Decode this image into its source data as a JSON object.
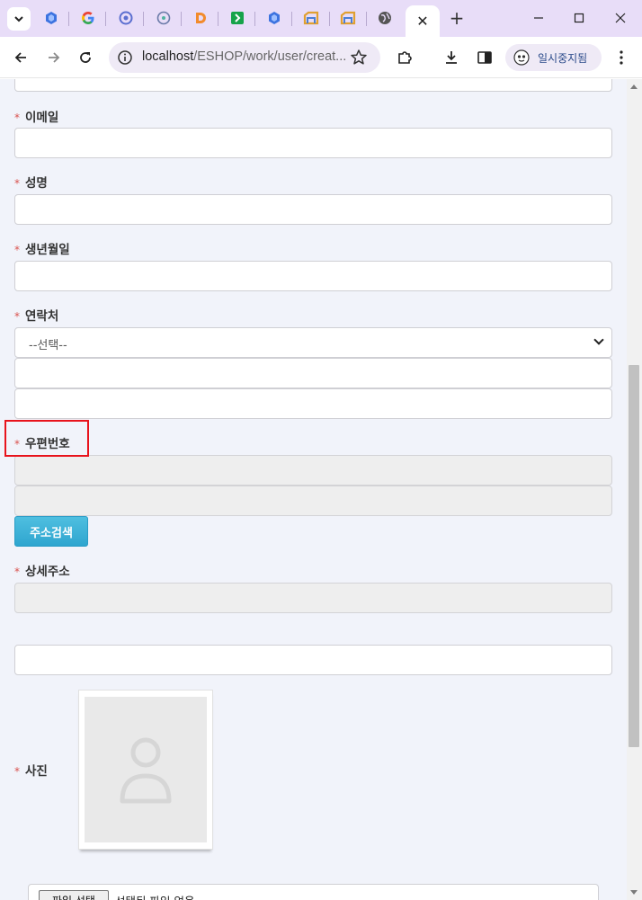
{
  "browser": {
    "tabs": [
      {
        "icon": "shield-hex-icon",
        "color": "#3c73e0"
      },
      {
        "icon": "google-icon",
        "color": "#4285f4"
      },
      {
        "icon": "circle-logo-icon",
        "color": "#5b6fd0"
      },
      {
        "icon": "aperture-icon",
        "color": "#6a7aa8"
      },
      {
        "icon": "d-logo-icon",
        "color": "#f28b2c"
      },
      {
        "icon": "green-arrow-icon",
        "color": "#16a34a"
      },
      {
        "icon": "shield-hex-icon",
        "color": "#3c73e0"
      },
      {
        "icon": "drive-like-icon",
        "color": "#e0a030"
      },
      {
        "icon": "drive-like-icon",
        "color": "#e0a030"
      },
      {
        "icon": "globe-icon",
        "color": "#555555"
      }
    ],
    "active_tab_close": "✕",
    "new_tab": "+",
    "url_host": "localhost",
    "url_path": "/ESHOP/work/user/creat...",
    "profile_label": "일시중지됨"
  },
  "form": {
    "required_mark": "*",
    "email_label": "이메일",
    "name_label": "성명",
    "birth_label": "생년월일",
    "contact_label": "연락처",
    "contact_select": "--선택--",
    "zip_label": "우편번호",
    "address_search_button": "주소검색",
    "detail_address_label": "상세주소",
    "photo_label": "사진",
    "file_button": "파일 선택",
    "file_status": "선택된 파일 없음"
  },
  "colors": {
    "required": "#d9534f",
    "highlight": "#e8131c",
    "button": "#3aaed6"
  }
}
